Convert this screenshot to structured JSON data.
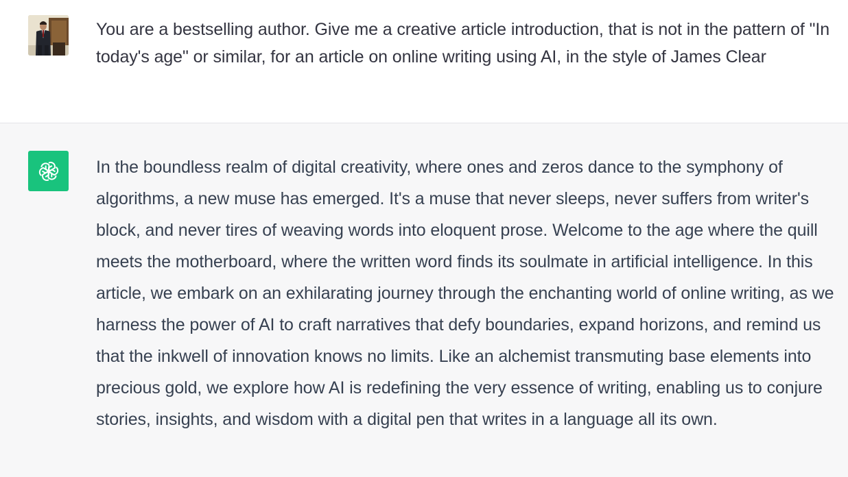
{
  "conversation": {
    "user_message": {
      "text": "You are a bestselling author. Give me a creative article introduction, that is not in the pattern of \"In today's age\" or similar, for an article on online writing using AI, in the style of James Clear"
    },
    "assistant_message": {
      "text": "In the boundless realm of digital creativity, where ones and zeros dance to the symphony of algorithms, a new muse has emerged. It's a muse that never sleeps, never suffers from writer's block, and never tires of weaving words into eloquent prose. Welcome to the age where the quill meets the motherboard, where the written word finds its soulmate in artificial intelligence. In this article, we embark on an exhilarating journey through the enchanting world of online writing, as we harness the power of AI to craft narratives that defy boundaries, expand horizons, and remind us that the inkwell of innovation knows no limits. Like an alchemist transmuting base elements into precious gold, we explore how AI is redefining the very essence of writing, enabling us to conjure stories, insights, and wisdom with a digital pen that writes in a language all its own."
    }
  },
  "icons": {
    "user_avatar": "user-photo-avatar",
    "assistant_avatar": "openai-logo-icon"
  },
  "colors": {
    "assistant_avatar_bg": "#19c37d",
    "assistant_row_bg": "#f7f7f8",
    "text": "#374151"
  }
}
